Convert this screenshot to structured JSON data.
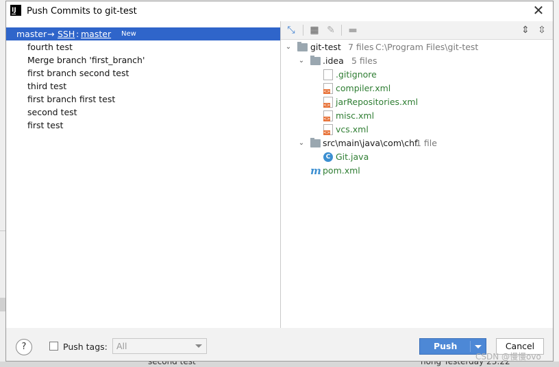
{
  "dialog": {
    "title": "Push Commits to git-test",
    "app_icon_text": "IJ"
  },
  "left": {
    "local_branch": "master",
    "arrow": "→",
    "remote": "SSH",
    "separator": ":",
    "remote_branch": "master",
    "badge": "New",
    "commits": [
      "fourth test",
      "Merge branch 'first_branch'",
      "first branch second test",
      "third test",
      "first branch first test",
      "second test",
      "first test"
    ]
  },
  "toolbar": {
    "icons": [
      "expand-arrows-icon",
      "group-by-icon",
      "edit-icon",
      "show-diff-icon",
      "expand-all-icon",
      "collapse-all-icon"
    ]
  },
  "tree": {
    "root": {
      "name": "git-test",
      "count": "7 files",
      "path": "C:\\Program Files\\git-test"
    },
    "idea": {
      "name": ".idea",
      "count": "5 files"
    },
    "idea_files": [
      ".gitignore",
      "compiler.xml",
      "jarRepositories.xml",
      "misc.xml",
      "vcs.xml"
    ],
    "src": {
      "name": "src\\main\\java\\com\\chf",
      "count": "1 file"
    },
    "java_file": "Git.java",
    "pom": "pom.xml"
  },
  "bottom": {
    "help": "?",
    "push_tags_label": "Push tags:",
    "push_tags_value": "All",
    "push_label": "Push",
    "cancel_label": "Cancel"
  },
  "background": {
    "row_text": "second test",
    "row_meta": "hong   Yesterday 23:22",
    "watermark": "CSDN @慢慢ovo"
  },
  "colors": {
    "selection": "#2f65ca",
    "primary_button": "#4d88d6",
    "file_modified": "#2e7d32"
  }
}
